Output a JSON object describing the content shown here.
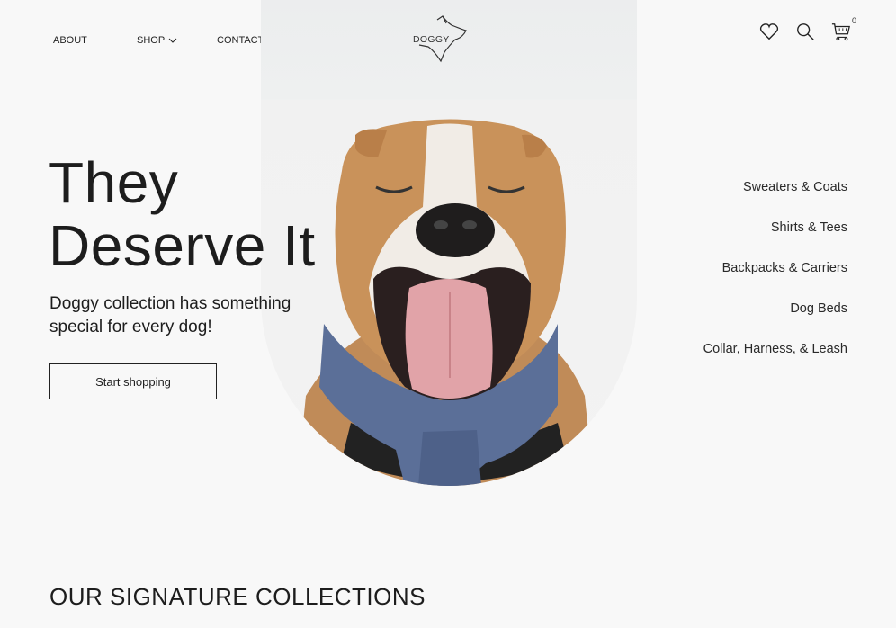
{
  "header": {
    "nav": {
      "about": "ABOUT",
      "shop": "SHOP",
      "contact": "CONTACT"
    },
    "logo_text": "DOGGY",
    "cart_count": "0",
    "icons": [
      "heart-icon",
      "search-icon",
      "cart-icon",
      "chevron-down-icon"
    ]
  },
  "hero": {
    "title_line1": "They",
    "title_line2": "Deserve It",
    "subtitle": "Doggy collection has something special for every dog!",
    "cta_label": "Start shopping"
  },
  "categories": [
    "Sweaters & Coats",
    "Shirts & Tees",
    "Backpacks & Carriers",
    "Dog Beds",
    "Collar, Harness, & Leash"
  ],
  "sections": {
    "signature_title": "OUR SIGNATURE COLLECTIONS"
  },
  "colors": {
    "background": "#f8f8f8",
    "text": "#1e1e1e",
    "scarf_blue": "#5b6f98",
    "dog_tan": "#c9925a"
  }
}
